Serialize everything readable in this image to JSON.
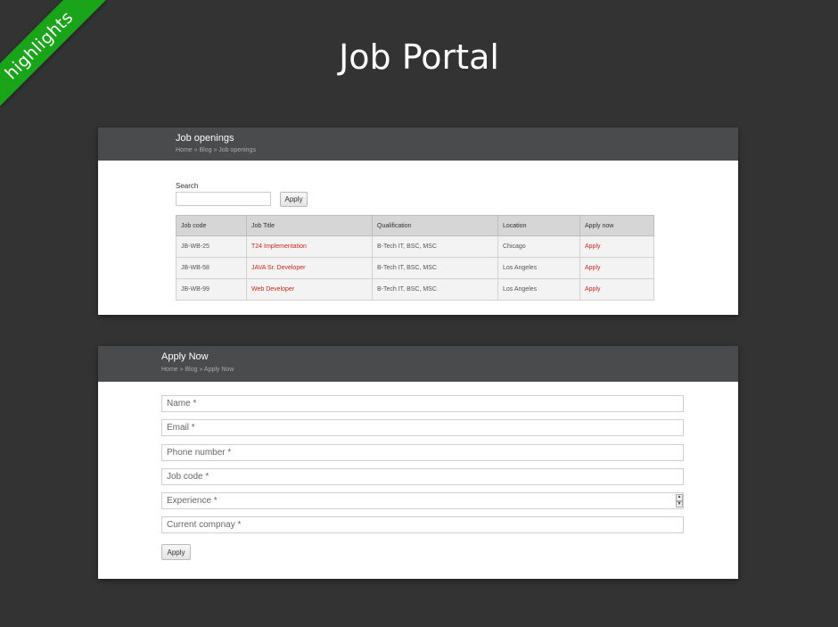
{
  "ribbon": {
    "text": "highlights"
  },
  "page": {
    "title": "Job Portal"
  },
  "jobs_section": {
    "title": "Job openings",
    "breadcrumb": [
      "Home",
      "Blog",
      "Job openings"
    ],
    "search": {
      "label": "Search",
      "value": "",
      "button": "Apply"
    },
    "table": {
      "headers": [
        "Job code",
        "Job Title",
        "Qualification",
        "Location",
        "Apply now"
      ],
      "rows": [
        {
          "code": "JB-WB-25",
          "title": "T24 Implementation",
          "qualification": "B-Tech IT, BSC, MSC",
          "location": "Chicago",
          "apply": "Apply"
        },
        {
          "code": "JB-WB-58",
          "title": "JAVA Sr. Developer",
          "qualification": "B-Tech IT, BSC, MSC",
          "location": "Los Angeles",
          "apply": "Apply"
        },
        {
          "code": "JB-WB-99",
          "title": "Web Developer",
          "qualification": "B-Tech IT, BSC, MSC",
          "location": "Los Angeles",
          "apply": "Apply"
        }
      ]
    }
  },
  "apply_section": {
    "title": "Apply Now",
    "breadcrumb": [
      "Home",
      "Blog",
      "Apply Now"
    ],
    "fields": {
      "name": "Name *",
      "email": "Email *",
      "phone": "Phone number *",
      "job_code": "Job code  *",
      "experience": "Experience *",
      "company": "Current compnay *"
    },
    "submit": "Apply"
  },
  "colors": {
    "background": "#333333",
    "ribbon": "#19a41a",
    "header": "#4a4b4d",
    "link": "#c8261b"
  }
}
